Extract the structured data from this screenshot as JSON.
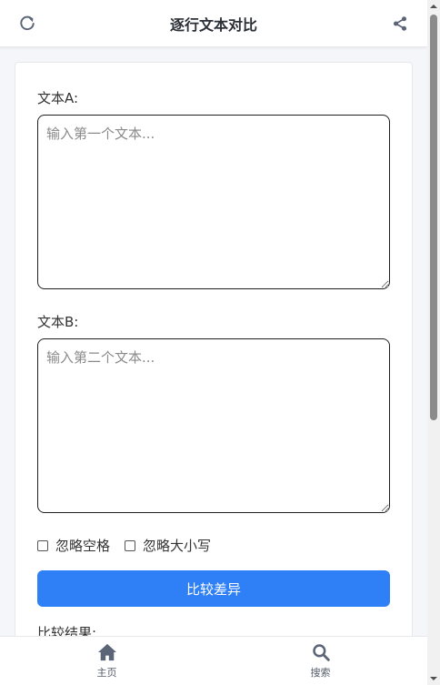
{
  "header": {
    "title": "逐行文本对比",
    "refresh_icon": "refresh-icon",
    "share_icon": "share-icon"
  },
  "form": {
    "text_a_label": "文本A:",
    "text_a_placeholder": "输入第一个文本...",
    "text_a_value": "",
    "text_b_label": "文本B:",
    "text_b_placeholder": "输入第二个文本...",
    "text_b_value": "",
    "options": [
      {
        "label": "忽略空格",
        "checked": false
      },
      {
        "label": "忽略大小写",
        "checked": false
      }
    ],
    "compare_button": "比较差异",
    "result_label": "比较结果:"
  },
  "bottom_nav": [
    {
      "label": "主页",
      "icon": "home-icon"
    },
    {
      "label": "搜索",
      "icon": "search-icon"
    }
  ],
  "colors": {
    "primary": "#2f80f6",
    "icon": "#5b6577",
    "background": "#f4f6f9"
  }
}
